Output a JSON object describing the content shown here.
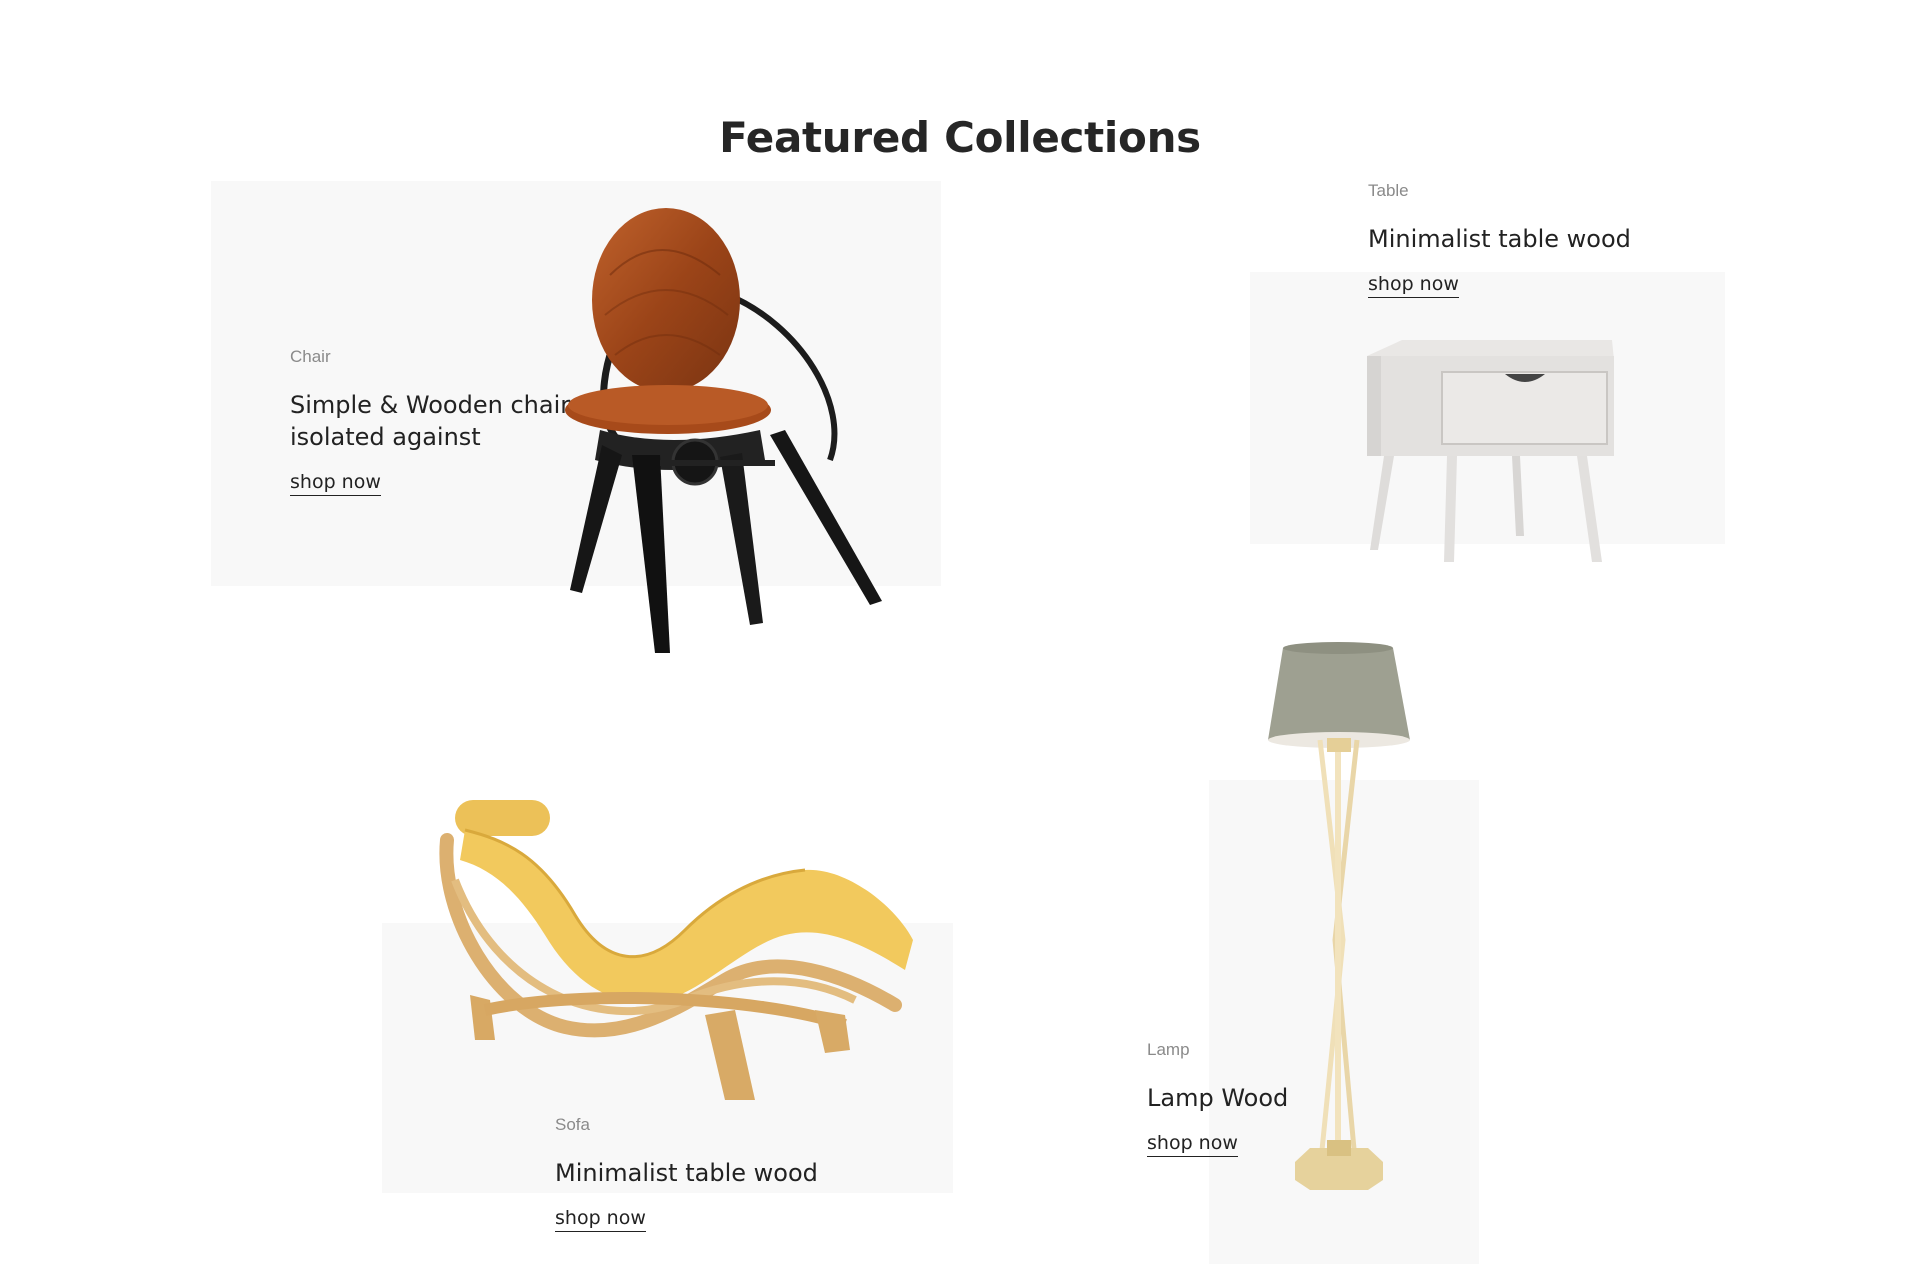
{
  "section": {
    "title": "Featured Collections"
  },
  "cards": [
    {
      "category": "Chair",
      "name": "Simple & Wooden chair isolated against",
      "link": "shop now",
      "icon": "chair-icon"
    },
    {
      "category": "Table",
      "name": "Minimalist table wood",
      "link": "shop now",
      "icon": "nightstand-icon"
    },
    {
      "category": "Sofa",
      "name": "Minimalist table wood",
      "link": "shop now",
      "icon": "lounge-chair-icon"
    },
    {
      "category": "Lamp",
      "name": "Lamp Wood",
      "link": "shop now",
      "icon": "floor-lamp-icon"
    }
  ]
}
